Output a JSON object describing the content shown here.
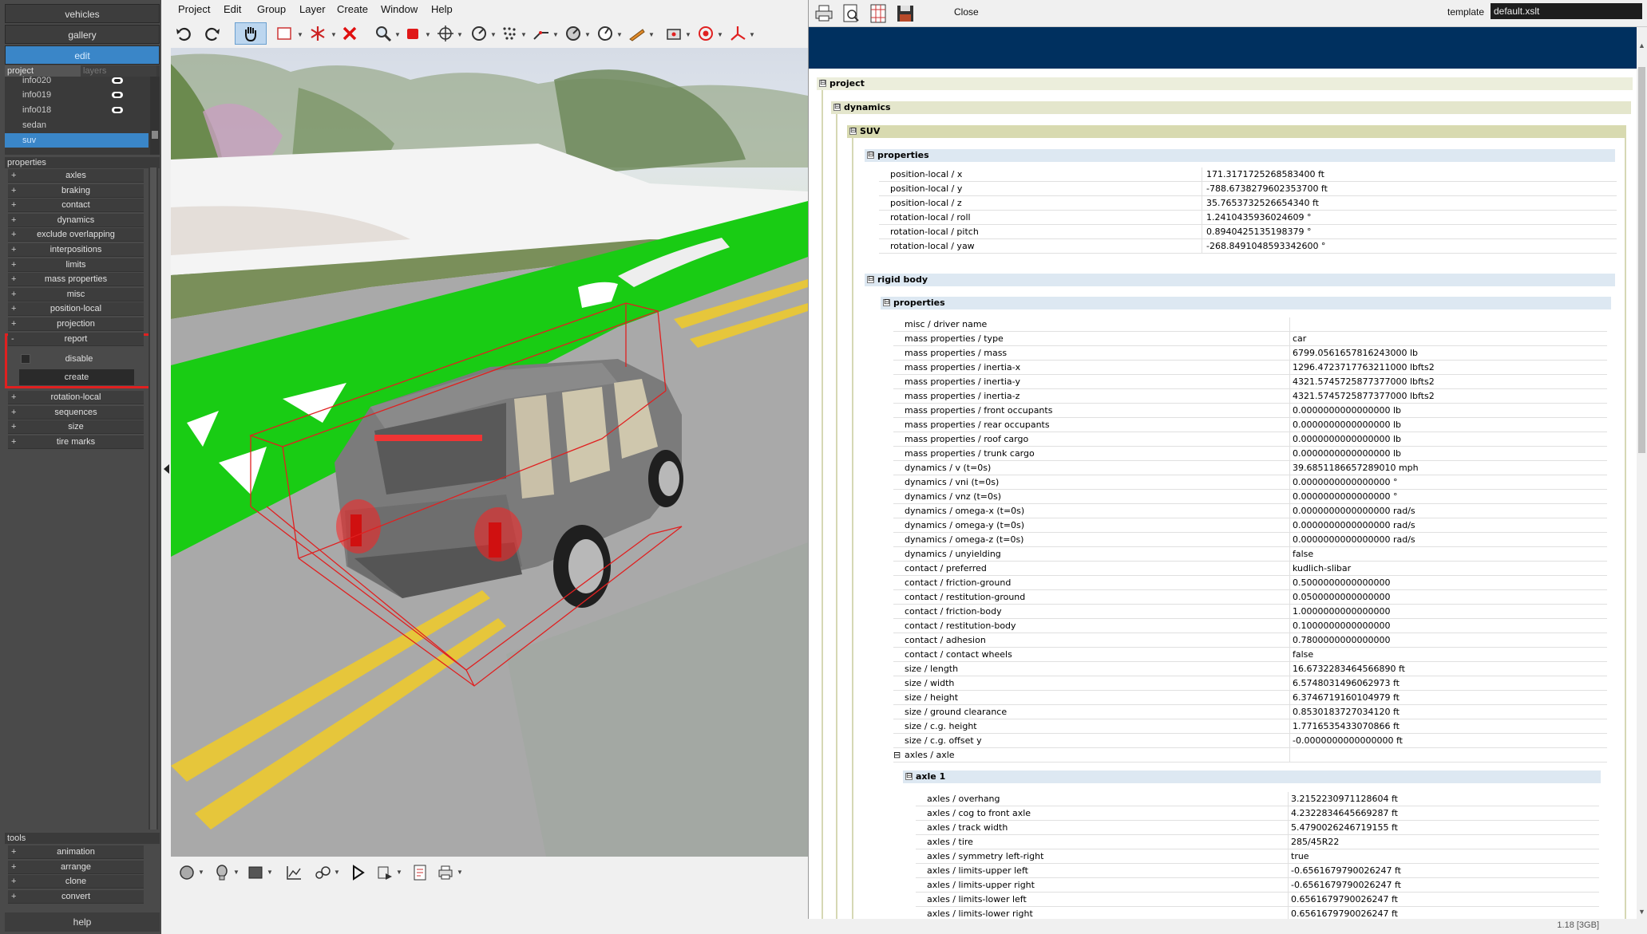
{
  "sidebar": {
    "top_buttons": [
      "vehicles",
      "gallery",
      "edit"
    ],
    "project_tabs": [
      "project",
      "layers"
    ],
    "project_items": [
      "info020",
      "info019",
      "info018",
      "sedan",
      "suv"
    ],
    "properties_header": "properties",
    "properties": [
      "axles",
      "braking",
      "contact",
      "dynamics",
      "exclude overlapping",
      "interpositions",
      "limits",
      "mass properties",
      "misc",
      "position-local",
      "projection",
      "report"
    ],
    "report_sub": {
      "disable": "disable",
      "create": "create"
    },
    "properties_after": [
      "rotation-local",
      "sequences",
      "size",
      "tire marks"
    ],
    "tools_header": "tools",
    "tools": [
      "animation",
      "arrange",
      "clone",
      "convert"
    ],
    "help": "help",
    "expand_symbol": "+",
    "collapse_symbol": "-"
  },
  "menubar": [
    "Project",
    "Edit",
    "Group",
    "Layer",
    "Create",
    "Window",
    "Help"
  ],
  "toolbar_icons": [
    "undo-icon",
    "redo-icon",
    "hand-tool-icon",
    "select-rect-icon",
    "explode-icon",
    "delete-icon",
    "zoom-icon",
    "cube-icon",
    "move-icon",
    "measure-icon",
    "points-icon",
    "path-icon",
    "angle-icon",
    "gauge-icon",
    "pencil-icon",
    "camera-icon",
    "target-icon",
    "axis-icon"
  ],
  "report": {
    "close": "Close",
    "template_label": "template",
    "template_value": "default.xslt",
    "project": "project",
    "dynamics": "dynamics",
    "suv": "SUV",
    "properties_label": "properties",
    "rigid_body": "rigid body",
    "axle_header": "axle 1",
    "toggle": "⊟",
    "position_rows": [
      {
        "k": "position-local / x",
        "v": "171.3171725268583400 ft"
      },
      {
        "k": "position-local / y",
        "v": "-788.6738279602353700 ft"
      },
      {
        "k": "position-local / z",
        "v": "35.7653732526654340 ft"
      },
      {
        "k": "rotation-local / roll",
        "v": "1.2410435936024609 °"
      },
      {
        "k": "rotation-local / pitch",
        "v": "0.8940425135198379 °"
      },
      {
        "k": "rotation-local / yaw",
        "v": "-268.8491048593342600 °"
      }
    ],
    "rigid_rows": [
      {
        "k": "misc / driver name",
        "v": ""
      },
      {
        "k": "mass properties / type",
        "v": "car"
      },
      {
        "k": "mass properties / mass",
        "v": "6799.0561657816243000 lb"
      },
      {
        "k": "mass properties / inertia-x",
        "v": "1296.4723717763211000 lbfts2"
      },
      {
        "k": "mass properties / inertia-y",
        "v": "4321.5745725877377000 lbfts2"
      },
      {
        "k": "mass properties / inertia-z",
        "v": "4321.5745725877377000 lbfts2"
      },
      {
        "k": "mass properties / front occupants",
        "v": "0.0000000000000000 lb"
      },
      {
        "k": "mass properties / rear occupants",
        "v": "0.0000000000000000 lb"
      },
      {
        "k": "mass properties / roof cargo",
        "v": "0.0000000000000000 lb"
      },
      {
        "k": "mass properties / trunk cargo",
        "v": "0.0000000000000000 lb"
      },
      {
        "k": "dynamics / v (t=0s)",
        "v": "39.6851186657289010 mph"
      },
      {
        "k": "dynamics / vni (t=0s)",
        "v": "0.0000000000000000 °"
      },
      {
        "k": "dynamics / vnz (t=0s)",
        "v": "0.0000000000000000 °"
      },
      {
        "k": "dynamics / omega-x (t=0s)",
        "v": "0.0000000000000000 rad/s"
      },
      {
        "k": "dynamics / omega-y (t=0s)",
        "v": "0.0000000000000000 rad/s"
      },
      {
        "k": "dynamics / omega-z (t=0s)",
        "v": "0.0000000000000000 rad/s"
      },
      {
        "k": "dynamics / unyielding",
        "v": "false"
      },
      {
        "k": "contact / preferred",
        "v": "kudlich-slibar"
      },
      {
        "k": "contact / friction-ground",
        "v": "0.5000000000000000"
      },
      {
        "k": "contact / restitution-ground",
        "v": "0.0500000000000000"
      },
      {
        "k": "contact / friction-body",
        "v": "1.0000000000000000"
      },
      {
        "k": "contact / restitution-body",
        "v": "0.1000000000000000"
      },
      {
        "k": "contact / adhesion",
        "v": "0.7800000000000000"
      },
      {
        "k": "contact / contact wheels",
        "v": "false"
      },
      {
        "k": "size / length",
        "v": "16.6732283464566890 ft"
      },
      {
        "k": "size / width",
        "v": "6.5748031496062973 ft"
      },
      {
        "k": "size / height",
        "v": "6.3746719160104979 ft"
      },
      {
        "k": "size / ground clearance",
        "v": "0.8530183727034120 ft"
      },
      {
        "k": "size / c.g. height",
        "v": "1.7716535433070866 ft"
      },
      {
        "k": "size / c.g. offset y",
        "v": "-0.0000000000000000 ft"
      },
      {
        "k": "axles / axle",
        "v": ""
      }
    ],
    "axle_rows": [
      {
        "k": "axles / overhang",
        "v": "3.2152230971128604 ft"
      },
      {
        "k": "axles / cog to front axle",
        "v": "4.2322834645669287 ft"
      },
      {
        "k": "axles / track width",
        "v": "5.4790026246719155 ft"
      },
      {
        "k": "axles / tire",
        "v": "285/45R22"
      },
      {
        "k": "axles / symmetry left-right",
        "v": "true"
      },
      {
        "k": "axles / limits-upper left",
        "v": "-0.6561679790026247 ft"
      },
      {
        "k": "axles / limits-upper right",
        "v": "-0.6561679790026247 ft"
      },
      {
        "k": "axles / limits-lower left",
        "v": "0.6561679790026247 ft"
      },
      {
        "k": "axles / limits-lower right",
        "v": "0.6561679790026247 ft"
      }
    ],
    "status": "1.18 [3GB]"
  },
  "colors": {
    "sidebar_bg": "#4a4a4a",
    "accent": "#3a86c8",
    "highlight_box": "#e02020",
    "banner": "#00305f"
  }
}
